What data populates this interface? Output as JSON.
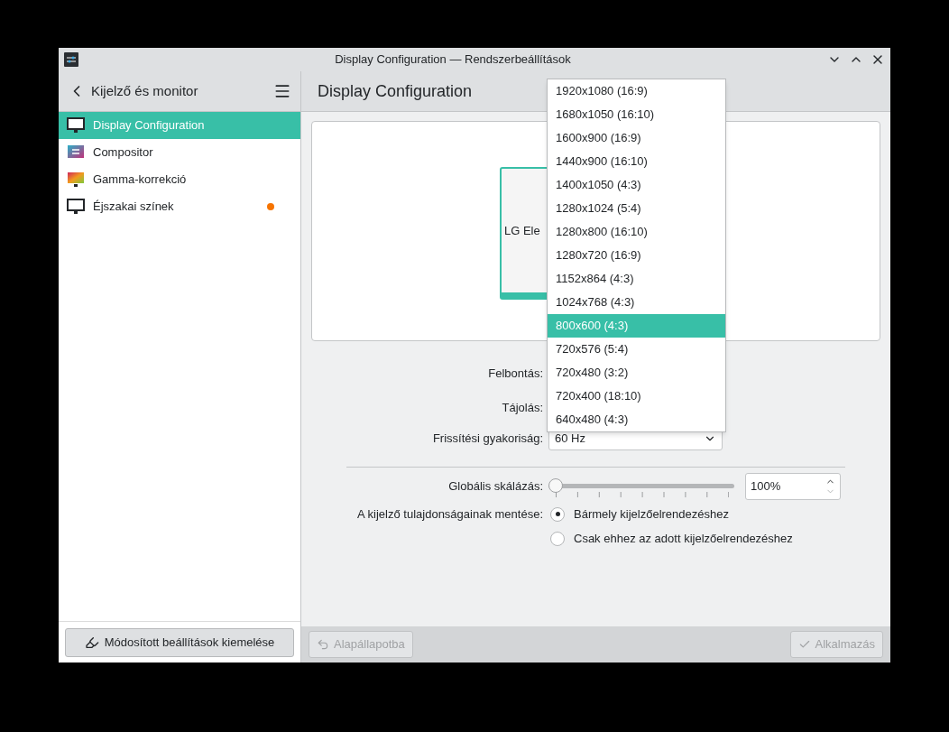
{
  "window": {
    "title": "Display Configuration — Rendszerbeállítások"
  },
  "sidebar": {
    "back_label": "Kijelző és monitor",
    "items": [
      {
        "label": "Display Configuration",
        "kind": "monitor",
        "selected": true,
        "notified": false
      },
      {
        "label": "Compositor",
        "kind": "compositor",
        "selected": false,
        "notified": false
      },
      {
        "label": "Gamma-korrekció",
        "kind": "gamma",
        "selected": false,
        "notified": false
      },
      {
        "label": "Éjszakai színek",
        "kind": "monitor",
        "selected": false,
        "notified": true
      }
    ],
    "highlight_button": "Módosított beállítások kiemelése"
  },
  "page": {
    "title": "Display Configuration",
    "monitor_label": "LG Ele"
  },
  "form": {
    "resolution_label": "Felbontás:",
    "orientation_label": "Tájolás:",
    "refresh_label": "Frissítési gyakoriság:",
    "refresh_value": "60 Hz",
    "scale_label": "Globális skálázás:",
    "scale": {
      "level": 0
    },
    "scale_value": "100%",
    "save_label": "A kijelző tulajdonságainak mentése:",
    "save_options": [
      {
        "label": "Bármely kijelzőelrendezéshez",
        "selected": true
      },
      {
        "label": "Csak ehhez az adott kijelzőelrendezéshez",
        "selected": false
      }
    ]
  },
  "dropdown": {
    "items": [
      {
        "label": "1920x1080 (16:9)",
        "selected": false
      },
      {
        "label": "1680x1050 (16:10)",
        "selected": false
      },
      {
        "label": "1600x900 (16:9)",
        "selected": false
      },
      {
        "label": "1440x900 (16:10)",
        "selected": false
      },
      {
        "label": "1400x1050 (4:3)",
        "selected": false
      },
      {
        "label": "1280x1024 (5:4)",
        "selected": false
      },
      {
        "label": "1280x800 (16:10)",
        "selected": false
      },
      {
        "label": "1280x720 (16:9)",
        "selected": false
      },
      {
        "label": "1152x864 (4:3)",
        "selected": false
      },
      {
        "label": "1024x768 (4:3)",
        "selected": false
      },
      {
        "label": "800x600 (4:3)",
        "selected": true
      },
      {
        "label": "720x576 (5:4)",
        "selected": false
      },
      {
        "label": "720x480 (3:2)",
        "selected": false
      },
      {
        "label": "720x400 (18:10)",
        "selected": false
      },
      {
        "label": "640x480 (4:3)",
        "selected": false
      }
    ]
  },
  "footer": {
    "buttons": [
      {
        "label": "Alapállapotba",
        "kind": "reset",
        "disabled": true
      },
      {
        "label": "Alkalmazás",
        "kind": "apply",
        "disabled": true
      }
    ]
  }
}
